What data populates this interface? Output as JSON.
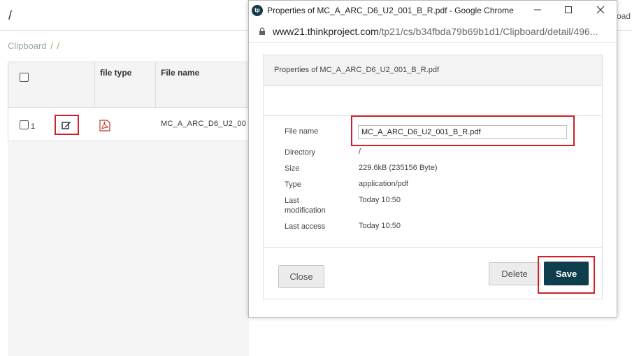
{
  "background": {
    "root_title": "/",
    "upload_fragment": "oad",
    "breadcrumb": {
      "label": "Clipboard",
      "sep1": "/",
      "sep2": "/"
    },
    "grid": {
      "headers": {
        "file_type": "file type",
        "file_name": "File name"
      },
      "rows": [
        {
          "number": "1",
          "file_name": "MC_A_ARC_D6_U2_00",
          "icon": "pdf-icon"
        }
      ]
    }
  },
  "popup": {
    "window_title": "Properties of MC_A_ARC_D6_U2_001_B_R.pdf - Google Chrome",
    "logo_text": "tp",
    "controls": {
      "minimize": "—",
      "maximize": "☐",
      "close": "✕"
    },
    "url_host": "www21.thinkproject.com",
    "url_path": "/tp21/cs/b34fbda79b69b1d1/Clipboard/detail/496...",
    "panel_title": "Properties of MC_A_ARC_D6_U2_001_B_R.pdf",
    "properties": {
      "file_name_label": "File name",
      "file_name_value": "MC_A_ARC_D6_U2_001_B_R.pdf",
      "directory_label": "Directory",
      "directory_value": "/",
      "size_label": "Size",
      "size_value": "229.6kB (235156 Byte)",
      "type_label": "Type",
      "type_value": "application/pdf",
      "last_mod_label": "Last modification",
      "last_mod_value": "Today 10:50",
      "last_access_label": "Last access",
      "last_access_value": "Today 10:50"
    },
    "buttons": {
      "close": "Close",
      "delete": "Delete",
      "save": "Save"
    }
  },
  "colors": {
    "accent": "#0e3d4b",
    "highlight": "#d0202a",
    "logo": "#163a4a"
  }
}
